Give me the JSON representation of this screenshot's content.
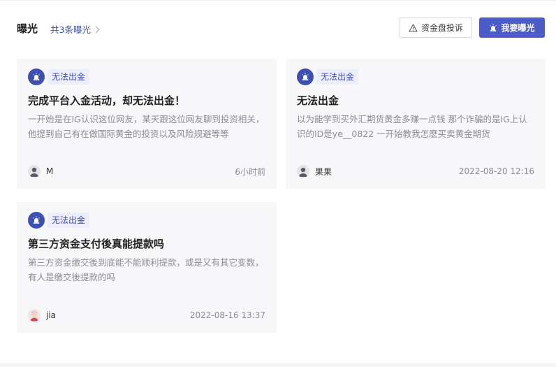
{
  "header": {
    "title": "曝光",
    "count_link": "共3条曝光",
    "complaint_button": "资金盘投诉",
    "expose_button": "我要曝光"
  },
  "cards": [
    {
      "tag": "无法出金",
      "title": "完成平台入金活动，却无法出金！",
      "excerpt": "一开始是在IG认识这位网友，某天跟这位网友聊到投资相关，他提到自己有在做国际黄金的投资以及风险规避等等",
      "author": "M",
      "time": "6小时前"
    },
    {
      "tag": "无法出金",
      "title": "无法出金",
      "excerpt": "以为能学到买外汇期货黄金多赚一点钱 那个诈骗的是IG上认识的ID是ye__0822 一开始教我怎麽买卖黄金期货",
      "author": "果果",
      "time": "2022-08-20 12:16"
    },
    {
      "tag": "无法出金",
      "title": "第三方资金支付後真能提款吗",
      "excerpt": "第三方资金缴交後到底能不能顺利提款，或是又有其它变数，有人是缴交後提款的吗",
      "author": "jia",
      "time": "2022-08-16 13:37"
    }
  ],
  "colors": {
    "accent": "#4b5bc9",
    "tag_text": "#3c4fb5",
    "tag_bg": "#eceefb",
    "card_bg": "#f7f7f9"
  },
  "icons": {
    "tag": "alarm-light-icon",
    "complaint": "warning-triangle-icon",
    "expose": "alarm-light-icon"
  }
}
